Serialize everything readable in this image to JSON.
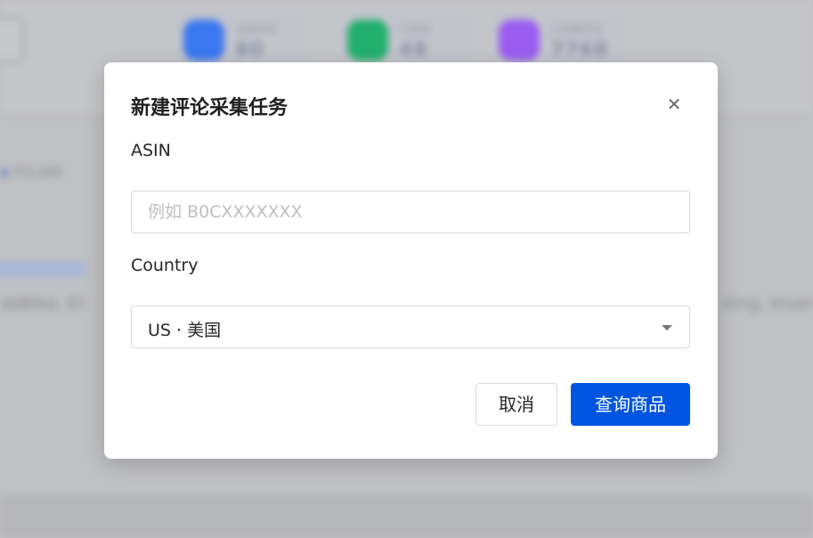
{
  "background": {
    "stats": [
      {
        "label": "全部任务",
        "value": "80",
        "color": "#3c78f0"
      },
      {
        "label": "已完成",
        "value": "48",
        "color": "#22b06e"
      },
      {
        "label": "已采集评论",
        "value": "7768",
        "color": "#9a5df0"
      }
    ],
    "filter_text": "FG-HM",
    "row_left": "ddBike, El",
    "row_right": "ding, Inver"
  },
  "modal": {
    "title": "新建评论采集任务",
    "close_icon": "close-icon",
    "asin": {
      "label": "ASIN",
      "value": "",
      "placeholder": "例如 B0CXXXXXXX"
    },
    "country": {
      "label": "Country",
      "selected": "US · 美国"
    },
    "cancel_label": "取消",
    "submit_label": "查询商品"
  },
  "colors": {
    "primary": "#0055e0",
    "overlay": "#bfc0c3"
  }
}
